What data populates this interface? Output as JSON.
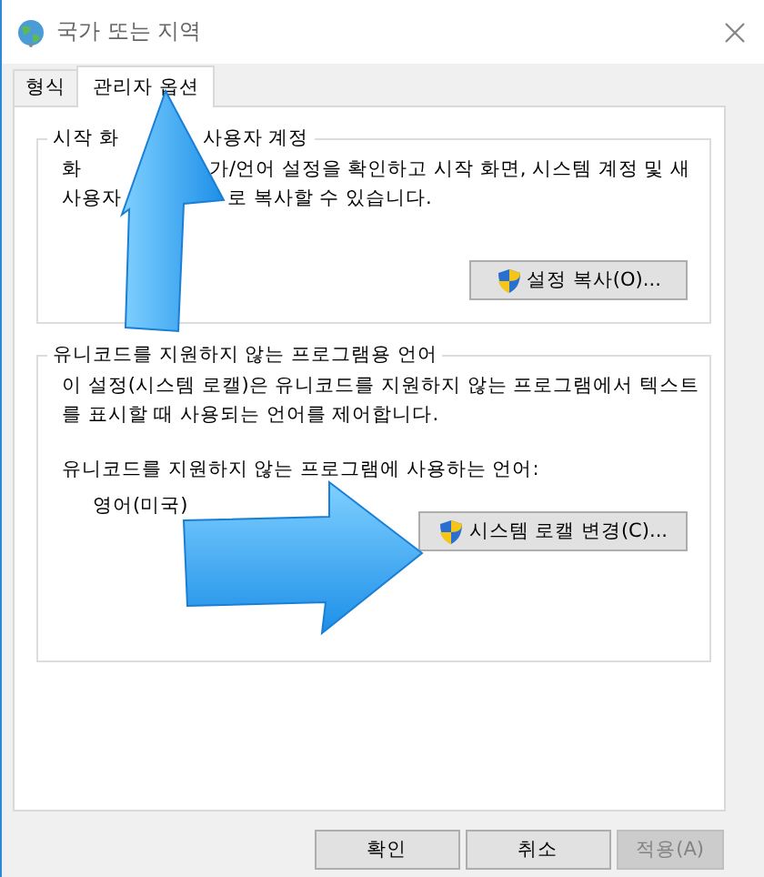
{
  "window": {
    "title": "국가 또는 지역"
  },
  "tabs": [
    {
      "label": "형식",
      "selected": false
    },
    {
      "label": "관리자 옵션",
      "selected": true
    }
  ],
  "groups": [
    {
      "title_parts": [
        "시작 화",
        "사용자 계정"
      ],
      "lines": [
        [
          "화",
          "가/언어 설정을 확인하고 시작 화면, 시스템 계정 및 새"
        ],
        [
          "사용자",
          "로 복사할 수 있습니다."
        ]
      ],
      "button": {
        "label": "설정 복사(O)...",
        "shield": true
      }
    },
    {
      "title_parts": [
        "유니코드를 지원하지 않는 프로그램용 언어"
      ],
      "lines": [
        [
          "이 설정(시스템 로캘)은 유니코드를 지원하지 않는 프로그램에서 텍스트"
        ],
        [
          "를 표시할 때 사용되는 언어를 제어합니다."
        ]
      ],
      "label": "유니코드를 지원하지 않는 프로그램에 사용하는 언어:",
      "value": "영어(미국)",
      "button": {
        "label": "시스템 로캘 변경(C)...",
        "shield": true
      }
    }
  ],
  "buttons": [
    {
      "label": "확인",
      "disabled": false
    },
    {
      "label": "취소",
      "disabled": false
    },
    {
      "label": "적용(A)",
      "disabled": true
    }
  ]
}
